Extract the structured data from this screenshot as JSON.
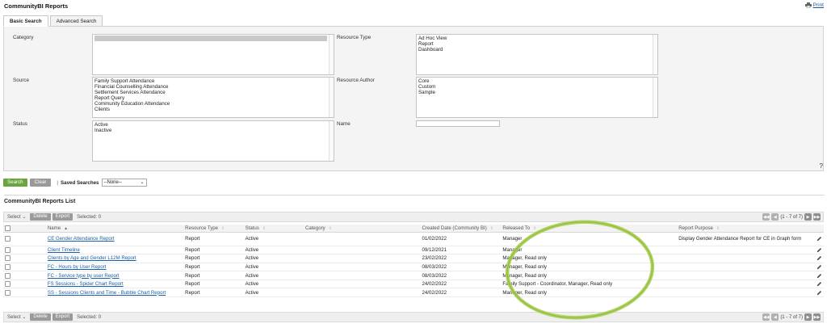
{
  "header": {
    "title": "CommunityBI Reports",
    "print_label": "Print"
  },
  "tabs": [
    {
      "label": "Basic Search",
      "active": true
    },
    {
      "label": "Advanced Search",
      "active": false
    }
  ],
  "filters": {
    "category_label": "Category",
    "source_label": "Source",
    "status_label": "Status",
    "resource_type_label": "Resource Type",
    "resource_author_label": "Resource Author",
    "name_label": "Name",
    "name_value": "",
    "source_options": [
      "Family Support Attendance",
      "Financial Counselling Attendance",
      "Settlement Services Attendance",
      "Report Query",
      "Community Education Attendance",
      "Clients"
    ],
    "status_options": [
      "Active",
      "Inactive"
    ],
    "resource_type_options": [
      "Ad Hoc View",
      "Report",
      "Dashboard"
    ],
    "resource_author_options": [
      "Core",
      "Custom",
      "Sample"
    ],
    "help": "?"
  },
  "actions": {
    "search": "Search",
    "clear": "Clear",
    "separator": "|",
    "saved_searches_label": "Saved Searches",
    "saved_searches_value": "--None--"
  },
  "list": {
    "title": "CommunityBI Reports List",
    "toolbar": {
      "select": "Select",
      "delete": "Delete",
      "export": "Export",
      "selected": "Selected: 0",
      "pager_text": "(1 - 7 of 7)"
    },
    "columns": [
      "Name",
      "Resource Type",
      "Status",
      "Category",
      "Created Date (Community BI)",
      "Released To",
      "Report Purpose"
    ],
    "rows": [
      {
        "name": "CE Gender Attendance Report",
        "type": "Report",
        "status": "Active",
        "category": "",
        "created": "01/02/2022",
        "released": "Manager",
        "purpose": "Display Gender Attendance Report for CE in Graph form"
      },
      {
        "name": "Client Timeline",
        "type": "Report",
        "status": "Active",
        "category": "",
        "created": "09/12/2021",
        "released": "Manager",
        "purpose": ""
      },
      {
        "name": "Clients by Age and Gender L12M Report",
        "type": "Report",
        "status": "Active",
        "category": "",
        "created": "23/02/2022",
        "released": "Manager, Read only",
        "purpose": ""
      },
      {
        "name": "FC - Hours by User Report",
        "type": "Report",
        "status": "Active",
        "category": "",
        "created": "08/03/2022",
        "released": "Manager, Read only",
        "purpose": ""
      },
      {
        "name": "FC - Service type by user Report",
        "type": "Report",
        "status": "Active",
        "category": "",
        "created": "08/03/2022",
        "released": "Manager, Read only",
        "purpose": ""
      },
      {
        "name": "FS Sessions - Spider Chart Report",
        "type": "Report",
        "status": "Active",
        "category": "",
        "created": "24/02/2022",
        "released": "Family Support - Coordinator, Manager, Read only",
        "purpose": ""
      },
      {
        "name": "SS - Sessions Clients and Time - Bubble Chart Report",
        "type": "Report",
        "status": "Active",
        "category": "",
        "created": "24/02/2022",
        "released": "Manager, Read only",
        "purpose": ""
      }
    ]
  },
  "colors": {
    "accent_green": "#6aa53f",
    "link_blue": "#1a5fa8",
    "highlight_ellipse": "#9bc53d"
  }
}
